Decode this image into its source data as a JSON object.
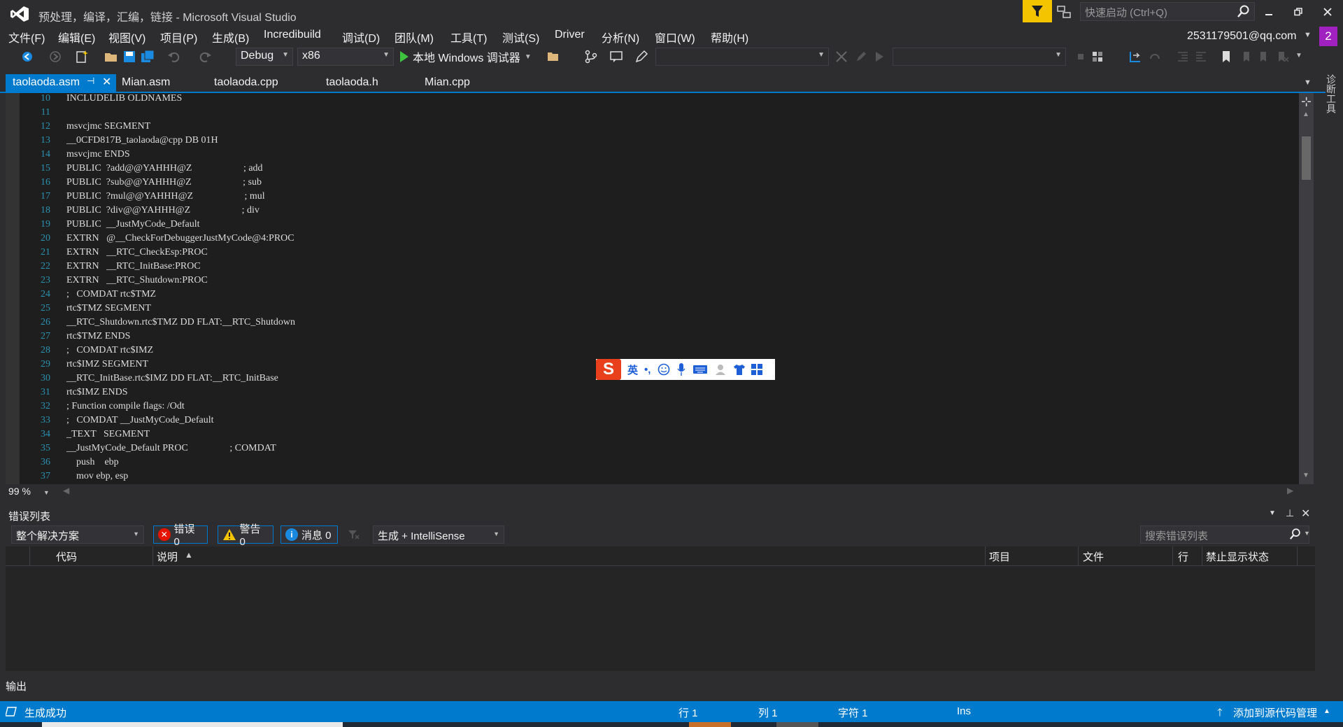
{
  "window": {
    "title": "预处理，编译，汇编，链接 - Microsoft Visual Studio",
    "quick_launch_placeholder": "快速启动 (Ctrl+Q)",
    "account": "2531179501@qq.com",
    "notification_count": "2"
  },
  "menu": [
    "文件(F)",
    "编辑(E)",
    "视图(V)",
    "项目(P)",
    "生成(B)",
    "Incredibuild",
    "调试(D)",
    "团队(M)",
    "工具(T)",
    "测试(S)",
    "Driver",
    "分析(N)",
    "窗口(W)",
    "帮助(H)"
  ],
  "toolbar": {
    "configuration": "Debug",
    "platform": "x86",
    "run_label": "本地 Windows 调试器"
  },
  "tabs": [
    {
      "label": "taolaoda.asm",
      "active": true
    },
    {
      "label": "Mian.asm"
    },
    {
      "label": "taolaoda.cpp"
    },
    {
      "label": "taolaoda.h"
    },
    {
      "label": "Mian.cpp"
    }
  ],
  "side_tool_tab": "诊断工具",
  "editor": {
    "zoom": "99 %",
    "lines": [
      {
        "n": "10",
        "text": "INCLUDELIB OLDNAMES"
      },
      {
        "n": "11",
        "text": ""
      },
      {
        "n": "12",
        "text": "msvcjmc SEGMENT"
      },
      {
        "n": "13",
        "text": "__0CFD817B_taolaoda@cpp DB 01H"
      },
      {
        "n": "14",
        "text": "msvcjmc ENDS"
      },
      {
        "n": "15",
        "text": "PUBLIC  ?add@@YAHHH@Z                     ; add"
      },
      {
        "n": "16",
        "text": "PUBLIC  ?sub@@YAHHH@Z                     ; sub"
      },
      {
        "n": "17",
        "text": "PUBLIC  ?mul@@YAHHH@Z                     ; mul"
      },
      {
        "n": "18",
        "text": "PUBLIC  ?div@@YAHHH@Z                     ; div"
      },
      {
        "n": "19",
        "text": "PUBLIC  __JustMyCode_Default"
      },
      {
        "n": "20",
        "text": "EXTRN   @__CheckForDebuggerJustMyCode@4:PROC"
      },
      {
        "n": "21",
        "text": "EXTRN   __RTC_CheckEsp:PROC"
      },
      {
        "n": "22",
        "text": "EXTRN   __RTC_InitBase:PROC"
      },
      {
        "n": "23",
        "text": "EXTRN   __RTC_Shutdown:PROC"
      },
      {
        "n": "24",
        "text": ";   COMDAT rtc$TMZ"
      },
      {
        "n": "25",
        "text": "rtc$TMZ SEGMENT"
      },
      {
        "n": "26",
        "text": "__RTC_Shutdown.rtc$TMZ DD FLAT:__RTC_Shutdown"
      },
      {
        "n": "27",
        "text": "rtc$TMZ ENDS"
      },
      {
        "n": "28",
        "text": ";   COMDAT rtc$IMZ"
      },
      {
        "n": "29",
        "text": "rtc$IMZ SEGMENT"
      },
      {
        "n": "30",
        "text": "__RTC_InitBase.rtc$IMZ DD FLAT:__RTC_InitBase"
      },
      {
        "n": "31",
        "text": "rtc$IMZ ENDS"
      },
      {
        "n": "32",
        "text": "; Function compile flags: /Odt"
      },
      {
        "n": "33",
        "text": ";   COMDAT __JustMyCode_Default"
      },
      {
        "n": "34",
        "text": "_TEXT   SEGMENT"
      },
      {
        "n": "35",
        "text": "__JustMyCode_Default PROC                 ; COMDAT"
      },
      {
        "n": "36",
        "text": "    push    ebp"
      },
      {
        "n": "37",
        "text": "    mov ebp, esp"
      }
    ]
  },
  "ime": {
    "logo": "S",
    "mode": "英",
    "punct": "•,"
  },
  "error_list": {
    "title": "错误列表",
    "scope": "整个解决方案",
    "errors": "错误 0",
    "warnings": "警告 0",
    "messages": "消息 0",
    "source": "生成 + IntelliSense",
    "search_placeholder": "搜索错误列表",
    "columns": {
      "code": "代码",
      "desc": "说明",
      "project": "项目",
      "file": "文件",
      "line": "行",
      "suppress": "禁止显示状态"
    }
  },
  "output_tab": "输出",
  "status": {
    "message": "生成成功",
    "row": "行 1",
    "col": "列 1",
    "char": "字符 1",
    "mode": "Ins",
    "source_control": "添加到源代码管理"
  },
  "colors": {
    "accent": "#007acc",
    "background": "#2d2d30",
    "editor_bg": "#1e1e1e",
    "line_number": "#2b91af",
    "filter_highlight": "#f5c400",
    "notification": "#a020c0"
  }
}
